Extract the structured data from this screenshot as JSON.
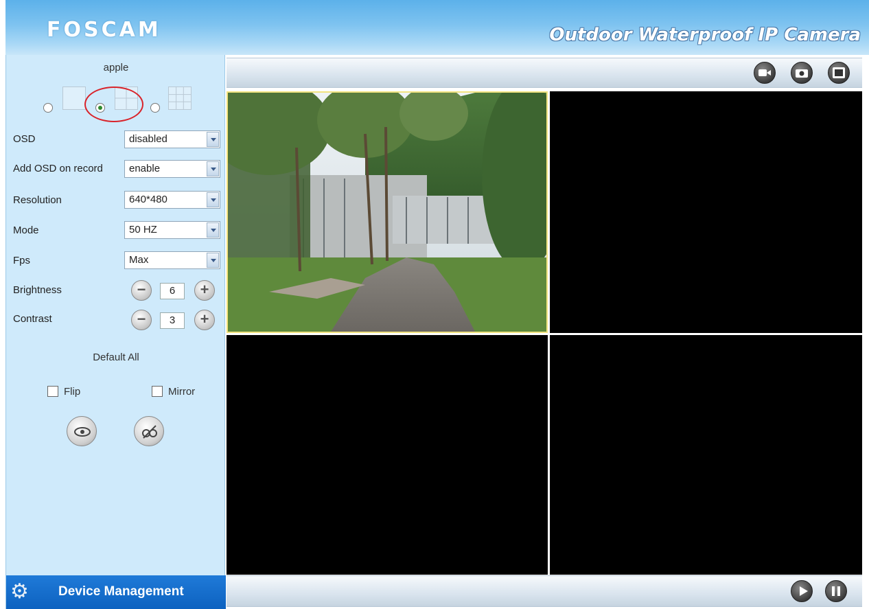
{
  "header": {
    "logo": "FOSCAM",
    "product_title": "Outdoor Waterproof IP Camera"
  },
  "sidebar": {
    "camera_name": "apple",
    "layout_options": [
      {
        "name": "single-view",
        "selected": false
      },
      {
        "name": "quad-view",
        "selected": true
      },
      {
        "name": "nine-view",
        "selected": false
      }
    ],
    "settings": [
      {
        "label": "OSD",
        "value": "disabled"
      },
      {
        "label": "Add OSD on record",
        "value": "enable"
      },
      {
        "label": "Resolution",
        "value": "640*480"
      },
      {
        "label": "Mode",
        "value": "50 HZ"
      },
      {
        "label": "Fps",
        "value": "Max"
      }
    ],
    "brightness": {
      "label": "Brightness",
      "value": "6"
    },
    "contrast": {
      "label": "Contrast",
      "value": "3"
    },
    "default_all": "Default All",
    "flip": {
      "label": "Flip",
      "checked": false
    },
    "mirror": {
      "label": "Mirror",
      "checked": false
    },
    "device_management": "Device Management"
  },
  "toolbar_icons": [
    "record-icon",
    "snapshot-icon",
    "fullscreen-icon"
  ],
  "playback_icons": [
    "play-icon",
    "pause-icon"
  ],
  "colors": {
    "header_gradient_top": "#5cb1ea",
    "sidebar_bg": "#cfeafb",
    "device_mgmt_bg": "#0d62c0",
    "active_cell_border": "#f2e380",
    "highlight_ring": "#d9232a"
  }
}
